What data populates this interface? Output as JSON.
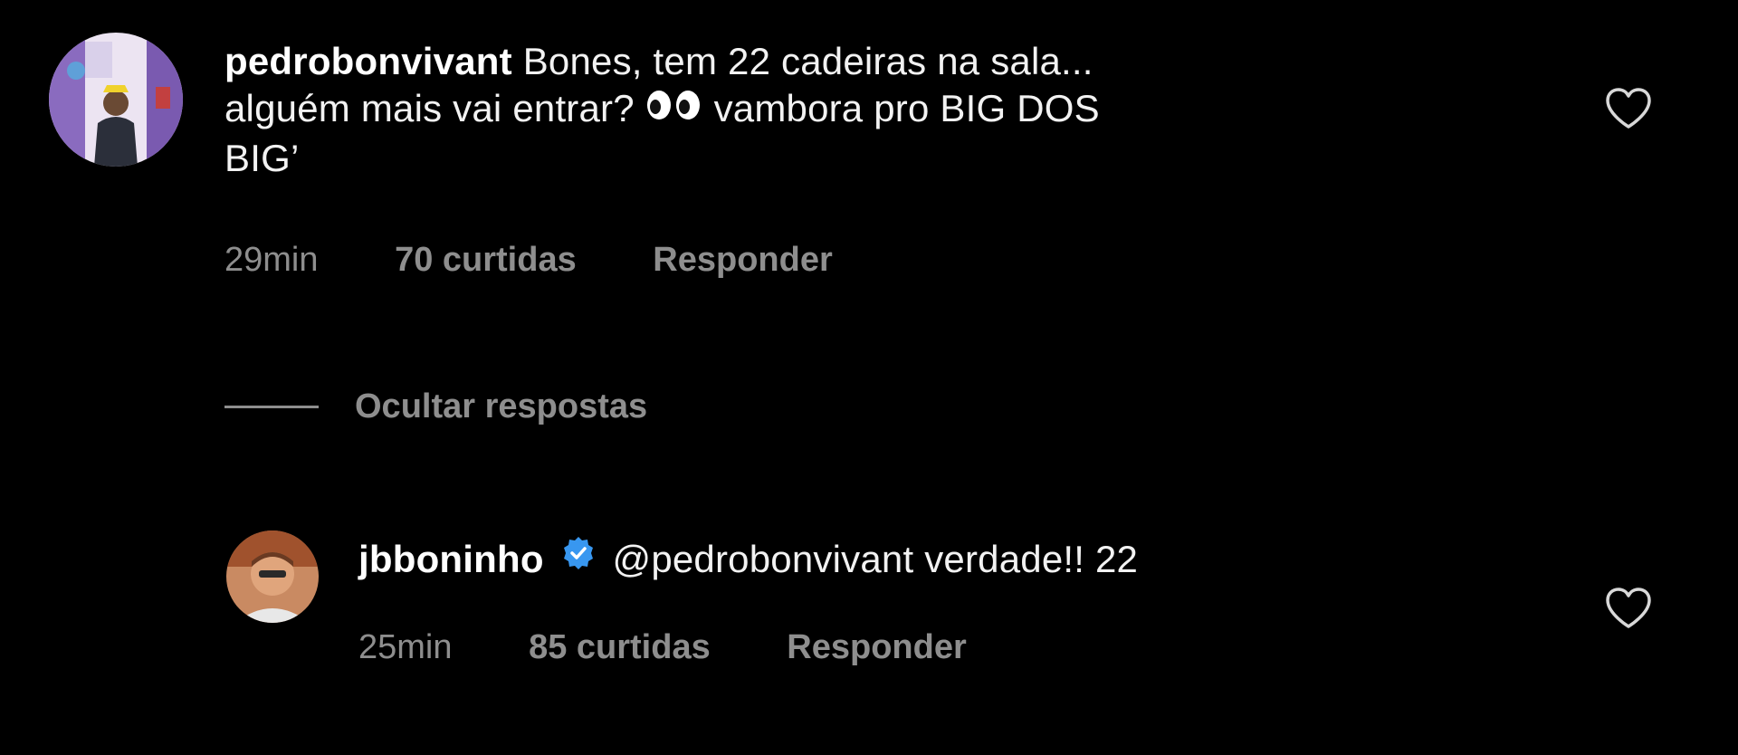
{
  "comment": {
    "username": "pedrobonvivant",
    "text_line1": "Bones, tem 22 cadeiras na sala...",
    "text_line2_pre": "alguém mais vai entrar?",
    "text_line2_emoji": "eyes-emoji",
    "text_line2_post": "vambora pro BIG DOS",
    "text_line3": "BIG’",
    "time": "29min",
    "likes": "70 curtidas",
    "reply_label": "Responder"
  },
  "replies_toggle": {
    "label": "Ocultar respostas"
  },
  "reply": {
    "username": "jbboninho",
    "verified_icon": "verified-badge-icon",
    "text": "@pedrobonvivant verdade!! 22",
    "time": "25min",
    "likes": "85 curtidas",
    "reply_label": "Responder"
  },
  "colors": {
    "background": "#000000",
    "text": "#f2f2f2",
    "secondary": "#8e8e8e",
    "verified": "#3897f0"
  }
}
